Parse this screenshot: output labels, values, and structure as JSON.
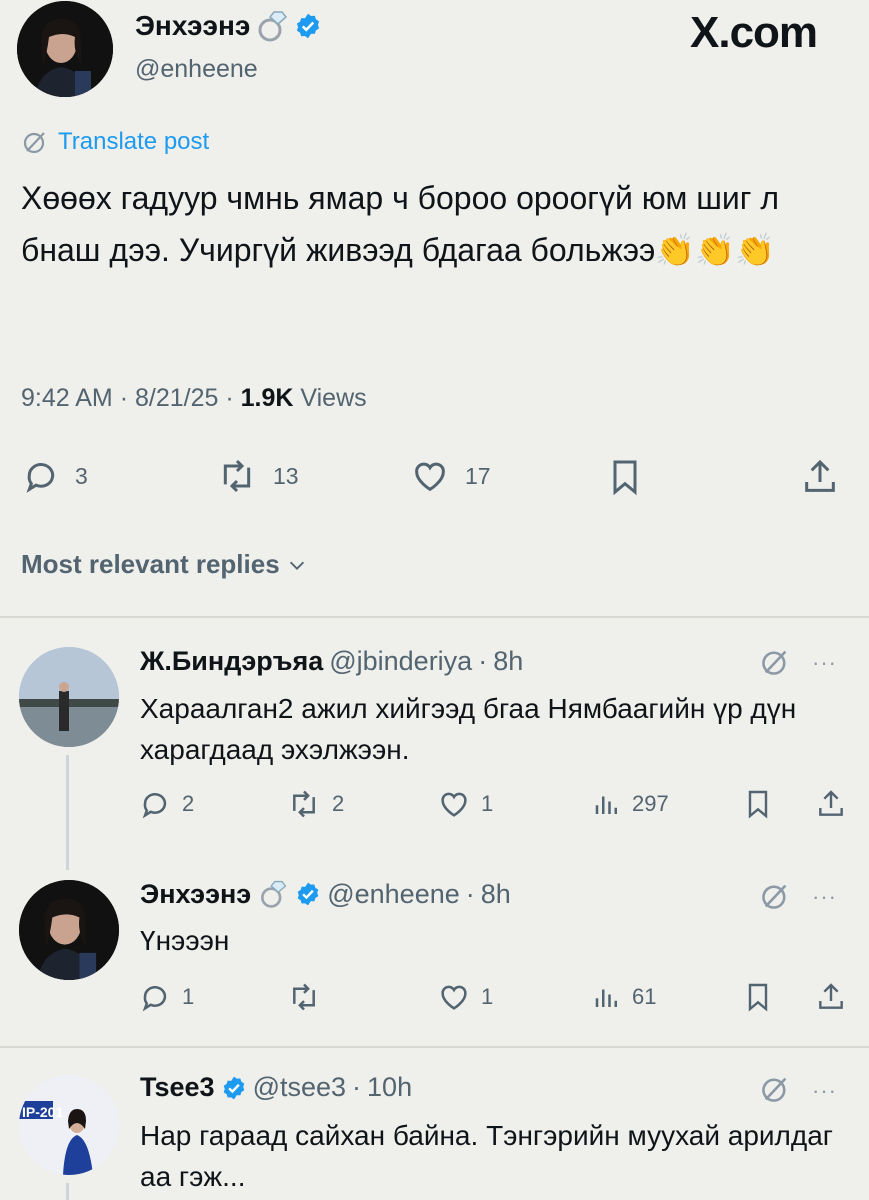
{
  "post": {
    "author_name": "Энхээнэ",
    "author_handle": "@enheene",
    "site": "X.com",
    "translate_label": "Translate post",
    "text": "Хөөөх гадуур чмнь ямар ч бороо ороогүй юм шиг л бнаш дээ. Учиргүй живээд бдагаа больжээ👏👏👏",
    "time": "9:42 AM",
    "date": "8/21/25",
    "views_count": "1.9K",
    "views_label": "Views",
    "replies": "3",
    "reposts": "13",
    "likes": "17"
  },
  "sort_label": "Most relevant replies",
  "replies": [
    {
      "name": "Ж.Биндэръяа",
      "handle": "@jbinderiya",
      "age": "8h",
      "text": "Хараалган2 ажил хийгээд бгаа Нямбаагийн үр дүн харагдаад эхэлжээн.",
      "replies": "2",
      "reposts": "2",
      "likes": "1",
      "views": "297"
    },
    {
      "name": "Энхээнэ",
      "handle": "@enheene",
      "age": "8h",
      "text": "Үнэээн",
      "replies": "1",
      "reposts": "",
      "likes": "1",
      "views": "61"
    },
    {
      "name": "Tsee3",
      "handle": "@tsee3",
      "age": "10h",
      "text": "Нар гараад сайхан байна. Тэнгэрийн муухай арилдаг аа гэж...",
      "avatar_banner": "IP-201"
    }
  ],
  "separator": "·",
  "more": "···",
  "colors": {
    "accent": "#1d9bf0",
    "muted": "#536471",
    "background": "#efefeb"
  },
  "icons": [
    "verified-badge-icon",
    "ring-emoji-icon",
    "grok-icon",
    "reply-icon",
    "repost-icon",
    "like-icon",
    "bookmark-icon",
    "share-icon",
    "views-icon",
    "chevron-down-icon"
  ]
}
